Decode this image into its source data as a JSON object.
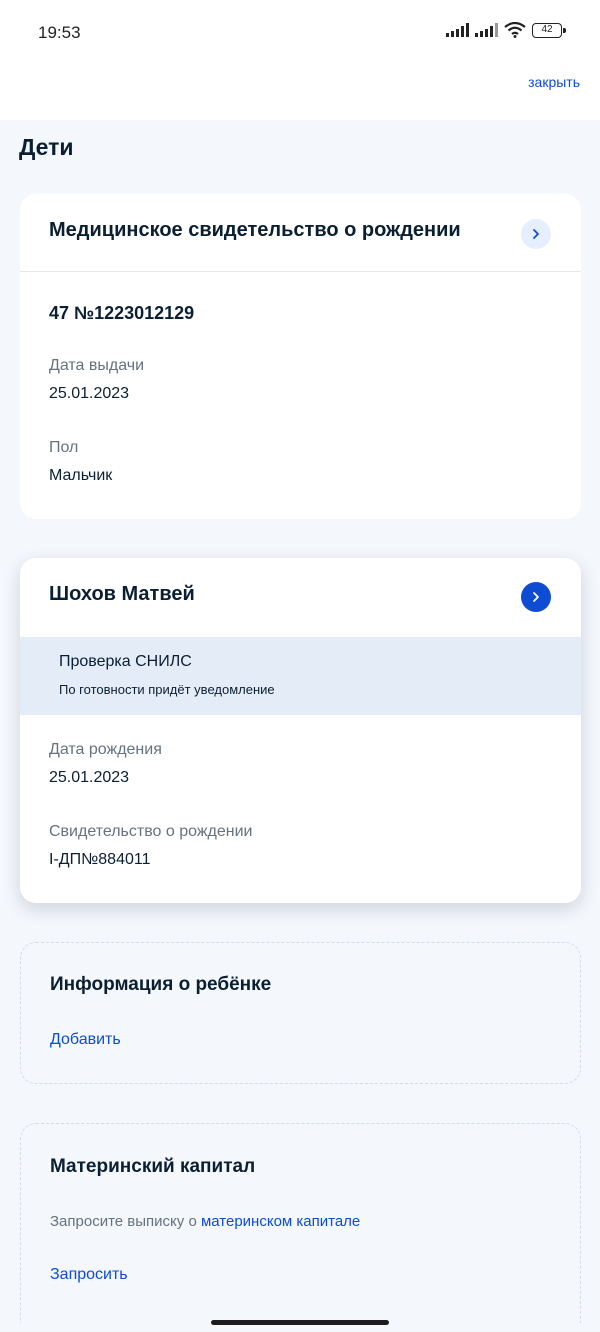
{
  "status_bar": {
    "time": "19:53",
    "battery": "42"
  },
  "header": {
    "close_label": "закрыть"
  },
  "page": {
    "title": "Дети"
  },
  "medical_certificate": {
    "title": "Медицинское свидетельство о рождении",
    "number": "47 №1223012129",
    "issue_date_label": "Дата выдачи",
    "issue_date_value": "25.01.2023",
    "gender_label": "Пол",
    "gender_value": "Мальчик",
    "chevron_icon": "chevron-right-icon"
  },
  "child": {
    "name": "Шохов Матвей",
    "snils_title": "Проверка СНИЛС",
    "snils_note": "По готовности придёт уведомление",
    "birth_date_label": "Дата рождения",
    "birth_date_value": "25.01.2023",
    "birth_cert_label": "Свидетельство о рождении",
    "birth_cert_value": "I-ДП№884011",
    "chevron_icon": "chevron-right-icon"
  },
  "child_info": {
    "title": "Информация о ребёнке",
    "add_label": "Добавить"
  },
  "maternity_capital": {
    "title": "Материнский капитал",
    "text_prefix": "Запросите выписку о",
    "text_link": "материнском капитале",
    "request_label": "Запросить"
  },
  "colors": {
    "accent": "#0d4cd3",
    "accent_light": "#e5efff",
    "band": "#e4ecf7",
    "text": "#0b1f33",
    "muted": "#66727f"
  }
}
